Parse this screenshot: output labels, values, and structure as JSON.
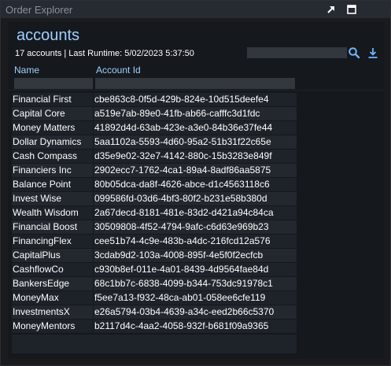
{
  "window": {
    "title": "Order Explorer"
  },
  "panel": {
    "heading": "accounts",
    "status": "17 accounts | Last Runtime: 5/02/2023 5:37:50",
    "search": {
      "value": "",
      "placeholder": ""
    }
  },
  "table": {
    "columns": [
      "Name",
      "Account Id"
    ],
    "rows": [
      {
        "name": "Financial First",
        "id": "cbe863c8-0f5d-429b-824e-10d515deefe4"
      },
      {
        "name": "Capital Core",
        "id": "a519e7ab-89e0-41fb-ab66-cafffc3d1fdc"
      },
      {
        "name": "Money Matters",
        "id": "41892d4d-63ab-423e-a3e0-84b36e37fe44"
      },
      {
        "name": "Dollar Dynamics",
        "id": "5aa1102a-5593-4d60-95a2-51b31f22c65e"
      },
      {
        "name": "Cash Compass",
        "id": "d35e9e02-32e7-4142-880c-15b3283e849f"
      },
      {
        "name": "Financiers Inc",
        "id": "2902ecc7-1762-4ca1-89a4-8adf86aa5875"
      },
      {
        "name": "Balance Point",
        "id": "80b05dca-da8f-4626-abce-d1c4563118c6"
      },
      {
        "name": "Invest Wise",
        "id": "099586fd-03d6-4bf3-80f2-b231e58b380d"
      },
      {
        "name": "Wealth Wisdom",
        "id": "2a67decd-8181-481e-83d2-d421a94c84ca"
      },
      {
        "name": "Financial Boost",
        "id": "30509808-4f52-4794-9afc-c6d63e969b23"
      },
      {
        "name": "FinancingFlex",
        "id": "cee51b74-4c9e-483b-a4dc-216fcd12a576"
      },
      {
        "name": "CapitalPlus",
        "id": "3cdab9d2-103a-4008-895f-4e5f0f2ecfcb"
      },
      {
        "name": "CashflowCo",
        "id": "c930b8ef-011e-4a01-8439-4d9564fae84d"
      },
      {
        "name": "BankersEdge",
        "id": "68c1bb7c-6838-4099-b344-753dc91978c1"
      },
      {
        "name": "MoneyMax",
        "id": "f5ee7a13-f932-48ca-ab01-058ee6cfe119"
      },
      {
        "name": "InvestmentsX",
        "id": "e26a5794-03b4-4639-a34c-eed2b66c5370"
      },
      {
        "name": "MoneyMentors",
        "id": "b2117d4c-4aa2-4058-932f-b681f09a9365"
      }
    ]
  },
  "icons": {
    "popout": "popout-icon",
    "maximize": "maximize-icon",
    "search": "search-icon",
    "download": "download-icon"
  },
  "colors": {
    "accent": "#9fd0ff",
    "background": "#1b1b1e",
    "titlebar": "#262a31"
  }
}
